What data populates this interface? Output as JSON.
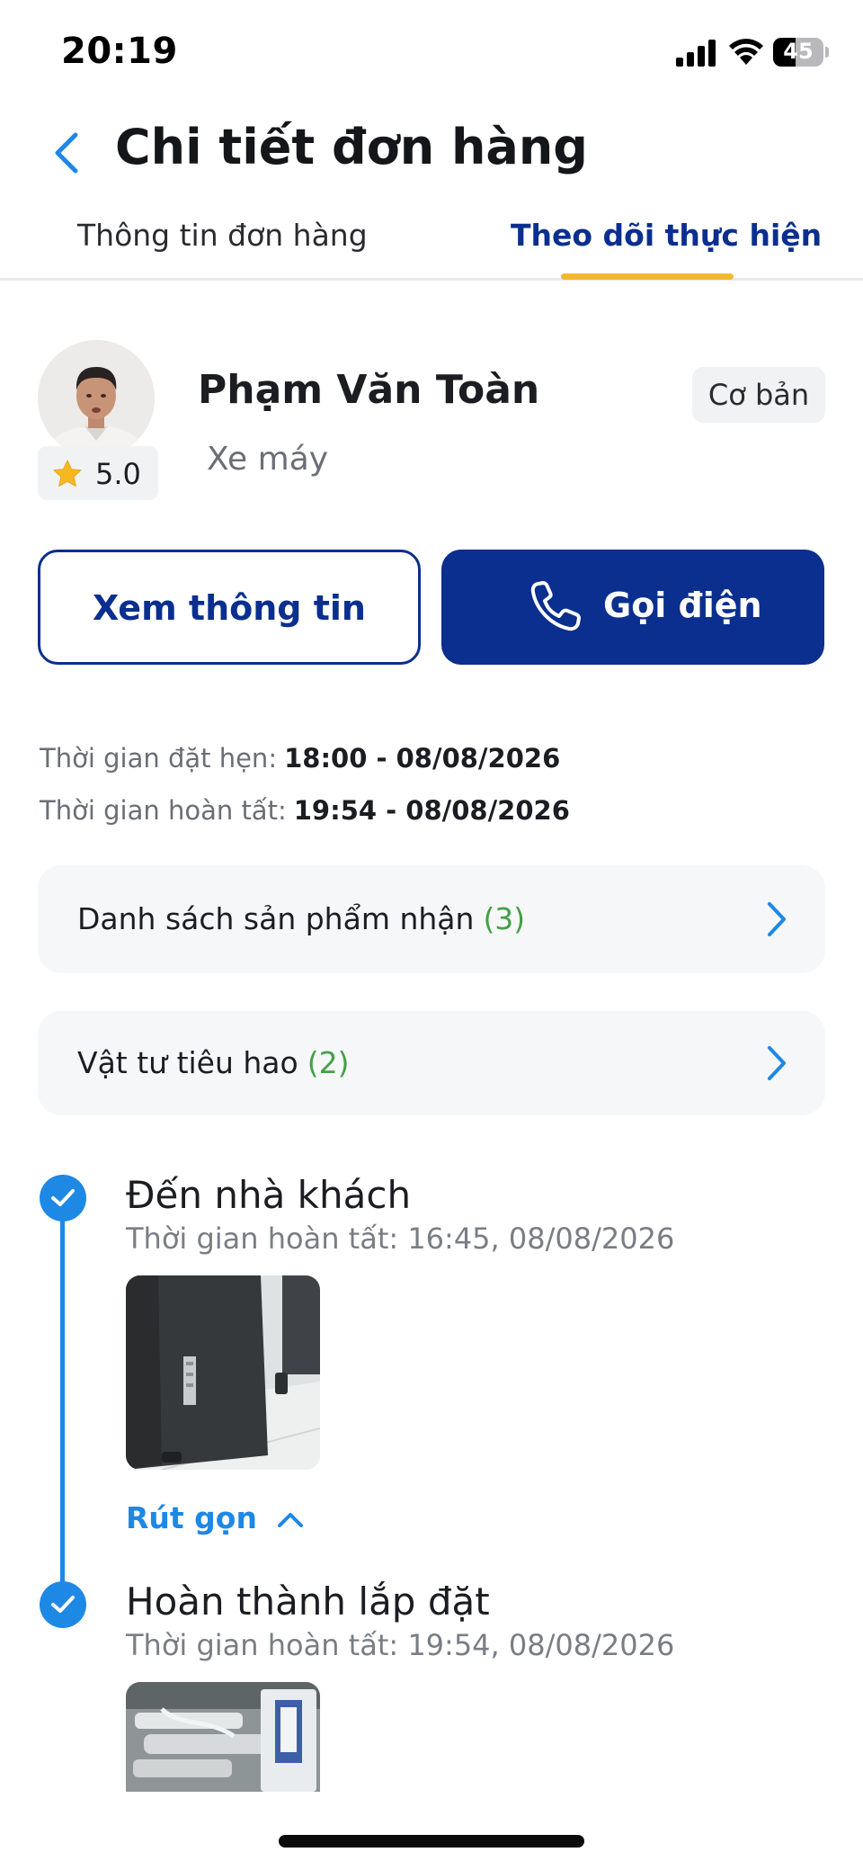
{
  "status_bar": {
    "time": "20:19",
    "battery": "45",
    "battery_level": 0.45
  },
  "header": {
    "title": "Chi tiết đơn hàng"
  },
  "tabs": [
    {
      "label": "Thông tin đơn hàng",
      "active": false
    },
    {
      "label": "Theo dõi thực hiện",
      "active": true
    }
  ],
  "driver": {
    "name": "Phạm Văn Toàn",
    "vehicle": "Xe máy",
    "rating": "5.0",
    "tier": "Cơ bản"
  },
  "actions": {
    "view_info": "Xem thông tin",
    "call": "Gọi điện"
  },
  "times": {
    "appointment_label": "Thời gian đặt hẹn:",
    "appointment_value": "18:00 - 08/08/2026",
    "completed_label": "Thời gian hoàn tất:",
    "completed_value": "19:54 - 08/08/2026"
  },
  "cards": [
    {
      "label": "Danh sách sản phẩm nhận",
      "count": "(3)"
    },
    {
      "label": "Vật tư tiêu hao",
      "count": "(2)"
    }
  ],
  "timeline": [
    {
      "title": "Đến nhà khách",
      "subtitle": "Thời gian hoàn tất: 16:45, 08/08/2026",
      "collapse_label": "Rút gọn"
    },
    {
      "title": "Hoàn thành lắp đặt",
      "subtitle": "Thời gian hoàn tất: 19:54, 08/08/2026"
    }
  ],
  "colors": {
    "primary": "#0b2f8f",
    "accent_blue": "#1e88e5",
    "tab_indicator": "#f2b930",
    "count_green": "#43a047",
    "card_bg": "#f6f7f8"
  },
  "icons": {
    "back": "chevron-left-icon",
    "star": "star-icon",
    "phone": "phone-icon",
    "chevron": "chevron-right-icon",
    "check": "check-icon",
    "collapse": "chevron-up-icon"
  }
}
